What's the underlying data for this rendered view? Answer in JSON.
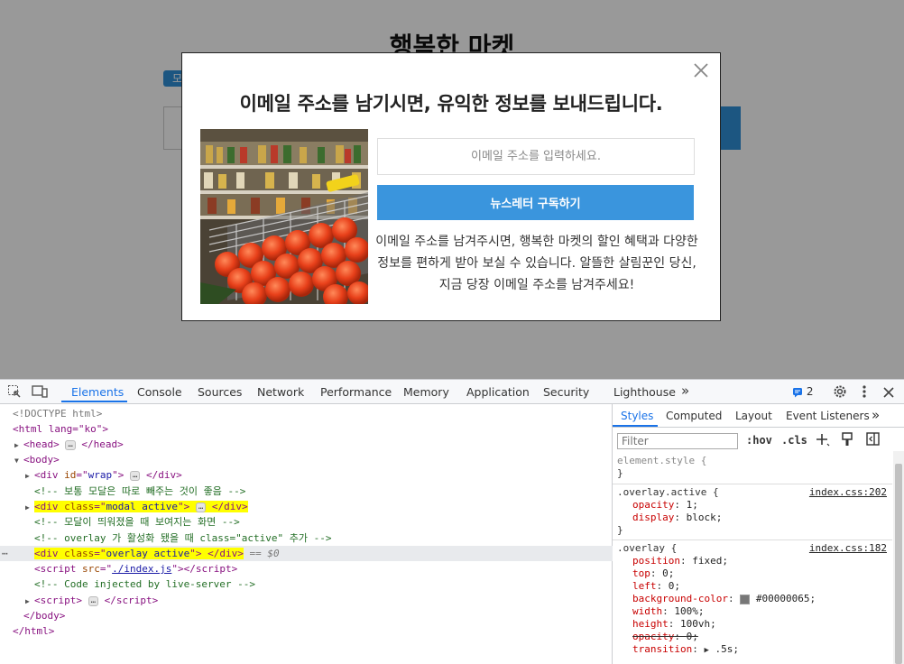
{
  "page": {
    "title": "행복한 마켓",
    "tag": "모",
    "input_hint": "이"
  },
  "modal": {
    "heading": "이메일 주소를 남기시면, 유익한 정보를 보내드립니다.",
    "email_placeholder": "이메일 주소를 입력하세요.",
    "subscribe_label": "뉴스레터 구독하기",
    "description": "이메일 주소를 남겨주시면, 행복한 마켓의 할인 혜택과 다양한 정보를 편하게 받아 보실 수 있습니다. 알뜰한 살림꾼인 당신, 지금 당장 이메일 주소를 남겨주세요!"
  },
  "devtools": {
    "tabs": [
      "Elements",
      "Console",
      "Sources",
      "Network",
      "Performance",
      "Memory",
      "Application",
      "Security",
      "Lighthouse"
    ],
    "issues_count": "2",
    "more_tabs": "»",
    "dom": {
      "doctype": "<!DOCTYPE html>",
      "html_open": "<html lang=\"ko\">",
      "head": "head",
      "body": "body",
      "wrap_attr": "id",
      "wrap_val": "wrap",
      "comment1": "<!-- 보통 모달은 따로 빼주는 것이 좋음 -->",
      "modal_val": "modal active",
      "comment2": "<!-- 모달이 띄워졌을 때 보여지는 화면 -->",
      "comment3": "<!-- overlay 가 활성화 됐을 때 class=\"active\" 추가 -->",
      "overlay_val": "overlay active",
      "selected_marker": "== $0",
      "script_src": "./index.js",
      "comment4": "<!-- Code injected by live-server -->",
      "body_close": "</body>",
      "html_close": "</html>"
    },
    "styles": {
      "tabs": [
        "Styles",
        "Computed",
        "Layout",
        "Event Listeners"
      ],
      "filter_placeholder": "Filter",
      "hov": ":hov",
      "cls": ".cls",
      "element_style": "element.style {",
      "rule1_selector": ".overlay.active {",
      "rule1_source": "index.css:202",
      "rule1_props": [
        {
          "name": "opacity",
          "value": "1;"
        },
        {
          "name": "display",
          "value": "block;"
        }
      ],
      "rule2_selector": ".overlay {",
      "rule2_source": "index.css:182",
      "rule2_props": [
        {
          "name": "position",
          "value": "fixed;"
        },
        {
          "name": "top",
          "value": "0;"
        },
        {
          "name": "left",
          "value": "0;"
        },
        {
          "name": "background-color",
          "value": "#00000065;"
        },
        {
          "name": "width",
          "value": "100%;"
        },
        {
          "name": "height",
          "value": "100vh;"
        },
        {
          "name": "opacity",
          "value": "0;"
        },
        {
          "name": "transition",
          "value": ".5s;"
        }
      ],
      "swatch_color": "#00000065"
    }
  }
}
